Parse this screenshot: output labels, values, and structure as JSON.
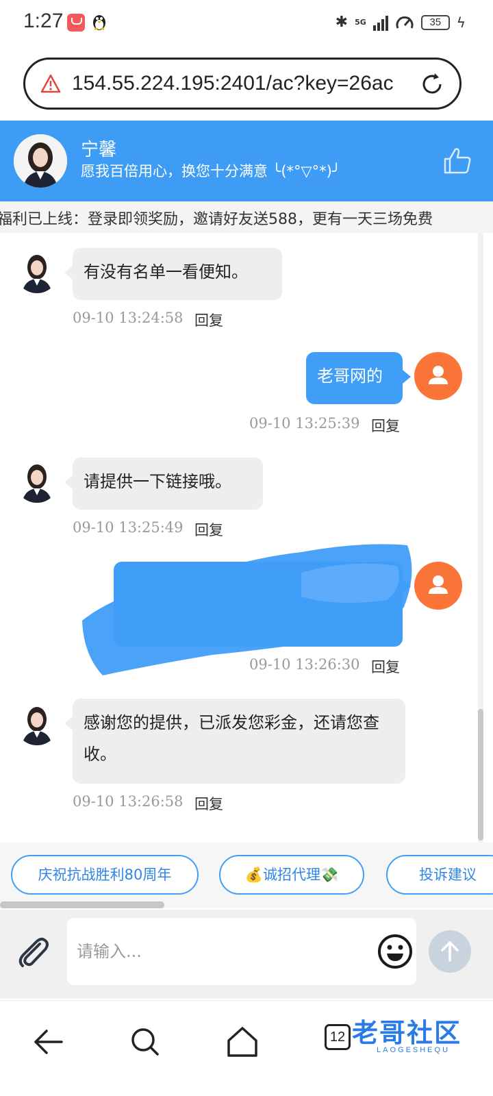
{
  "status_bar": {
    "time": "1:27",
    "network": "5G",
    "battery": "35"
  },
  "browser": {
    "url": "154.55.224.195:2401/ac?key=26ac"
  },
  "chat_header": {
    "agent_name": "宁馨",
    "agent_tagline": "愿我百倍用心，换您十分满意 ╰(*°▽°*)╯"
  },
  "announcement": {
    "text": "福利已上线：登录即领奖励，邀请好友送588，更有一天三场免费"
  },
  "messages": [
    {
      "sender": "agent",
      "text": "有没有名单一看便知。",
      "timestamp": "09-10 13:24:58",
      "reply_label": "回复"
    },
    {
      "sender": "user",
      "text": "老哥网的",
      "timestamp": "09-10 13:25:39",
      "reply_label": "回复"
    },
    {
      "sender": "agent",
      "text": "请提供一下链接哦。",
      "timestamp": "09-10 13:25:49",
      "reply_label": "回复"
    },
    {
      "sender": "user",
      "text": "",
      "timestamp": "09-10 13:26:30",
      "reply_label": "回复"
    },
    {
      "sender": "agent",
      "text": "感谢您的提供，已派发您彩金，还请您查收。",
      "timestamp": "09-10 13:26:58",
      "reply_label": "回复"
    }
  ],
  "quick_replies": [
    {
      "label": "庆祝抗战胜利80周年"
    },
    {
      "label": "💰诚招代理💸"
    },
    {
      "label": "投诉建议"
    }
  ],
  "input": {
    "placeholder": "请输入..."
  },
  "nav": {
    "tab_count": "12"
  },
  "watermark": {
    "text": "老哥社区",
    "sub": "LAOGESHEQU"
  },
  "colors": {
    "header_blue": "#3f9cf5",
    "user_bubble": "#409ef8",
    "user_avatar": "#fb7438",
    "bot_bubble": "#eeeeee"
  }
}
